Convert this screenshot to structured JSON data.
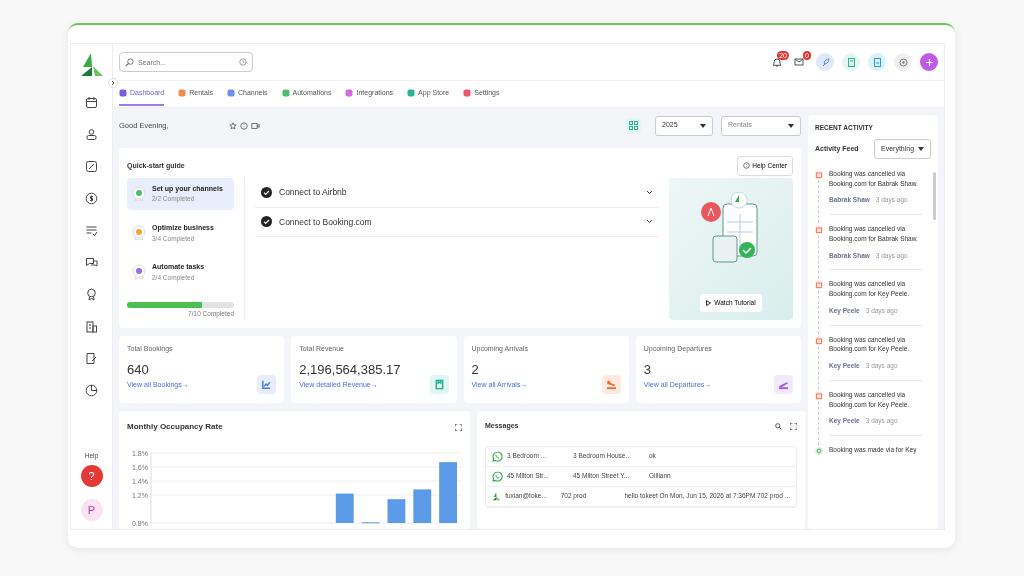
{
  "sidebar": {
    "help_label": "Help",
    "help_button": "?",
    "avatar": "P"
  },
  "header": {
    "search": {
      "placeholder": "Search..."
    },
    "notifications": "20",
    "messages": "0"
  },
  "tabs": [
    {
      "label": "Dashboard",
      "selected": true,
      "color": "#7c5ce0"
    },
    {
      "label": "Rentals",
      "selected": false,
      "color": "#f08a4b"
    },
    {
      "label": "Channels",
      "selected": false,
      "color": "#6f8fe8"
    },
    {
      "label": "Automations",
      "selected": false,
      "color": "#4cbf6b"
    },
    {
      "label": "Integrations",
      "selected": false,
      "color": "#d46be0"
    },
    {
      "label": "App Store",
      "selected": false,
      "color": "#2bb39a"
    },
    {
      "label": "Settings",
      "selected": false,
      "color": "#e8596a"
    }
  ],
  "greeting": "Good Evening,",
  "filters": {
    "year": "2025",
    "rentals": {
      "placeholder": "Rentals"
    }
  },
  "quick_start": {
    "title": "Quick-start guide",
    "help_button": "Help Center",
    "steps": [
      {
        "title": "Set up your channels",
        "progress": "2/2 Completed",
        "selected": true,
        "color": "#4cbf6b"
      },
      {
        "title": "Optimize business",
        "progress": "3/4 Completed",
        "selected": false,
        "color": "#f0a830"
      },
      {
        "title": "Automate tasks",
        "progress": "2/4 Completed",
        "selected": false,
        "color": "#9b6be0"
      }
    ],
    "level": 0.7,
    "progress_text": "7/10 Completed",
    "tasks": [
      {
        "label": "Connect to Airbnb",
        "checked": true
      },
      {
        "label": "Connect to Booking.com",
        "checked": true
      }
    ],
    "tutorial_button": "Watch Tutorial"
  },
  "stats": [
    {
      "label": "Total Bookings",
      "value": "640",
      "link": "View all Bookings→",
      "kind": "chart",
      "color": "#4a7fd0"
    },
    {
      "label": "Total Revenue",
      "value": "2,196,564,385.17",
      "link": "View detailed Revenue→",
      "kind": "receipt",
      "color": "#2bb39a"
    },
    {
      "label": "Upcoming Arrivals",
      "value": "2",
      "link": "View all Arrivals→",
      "kind": "arrival",
      "color": "#f06a2a"
    },
    {
      "label": "Upcoming Departures",
      "value": "3",
      "link": "View all Departures→",
      "kind": "departure",
      "color": "#a05ce0"
    }
  ],
  "occupancy": {
    "title": "Monthly Occupancy Rate",
    "chart_data": {
      "type": "bar",
      "grid": true,
      "ylim": [
        0.8,
        1.8
      ],
      "yticks": [
        {
          "value": 0.8,
          "label": "0.8%"
        },
        {
          "value": 1.2,
          "label": "1.2%"
        },
        {
          "value": 1.4,
          "label": "1.4%"
        },
        {
          "value": 1.6,
          "label": "1.6%"
        },
        {
          "value": 1.8,
          "label": "1.8%"
        }
      ],
      "series": [
        {
          "color": "#5b9be8",
          "values": [
            null,
            null,
            null,
            null,
            null,
            null,
            null,
            1.22,
            0.81,
            1.14,
            1.28,
            1.67
          ]
        }
      ]
    }
  },
  "messages": {
    "title": "Messages",
    "rows": [
      {
        "kind": "whatsapp",
        "guest": "3 Bedroom ...",
        "rental": "3 Bedroom House...",
        "text": "ok"
      },
      {
        "kind": "whatsapp",
        "guest": "45 Milton Str...",
        "rental": "45 Milton Street Y...",
        "text": "Gilliann"
      },
      {
        "kind": "tokeet",
        "guest": "fuxian@toke...",
        "rental": "702 prod",
        "text": "hello tokeet On Mon, Jun 15, 2026 at 7:36PM 702 prod ..."
      }
    ]
  },
  "activity": {
    "title": "RECENT ACTIVITY",
    "feed_label": "Activity Feed",
    "feed_select": "Everything",
    "items": [
      {
        "kind": "cancelled",
        "text": "Booking was cancelled via Booking.com for Babrak Shaw.",
        "author": "Babrak Shaw",
        "time": "3 days ago"
      },
      {
        "kind": "cancelled",
        "text": "Booking was cancelled via Booking.com for Babrak Shaw.",
        "author": "Babrak Shaw",
        "time": "3 days ago"
      },
      {
        "kind": "cancelled",
        "text": "Booking was cancelled via Booking.com for Key Peele.",
        "author": "Key Peele",
        "time": "3 days ago"
      },
      {
        "kind": "cancelled",
        "text": "Booking was cancelled via Booking.com for Key Peele.",
        "author": "Key Peele",
        "time": "3 days ago"
      },
      {
        "kind": "cancelled",
        "text": "Booking was cancelled via Booking.com for Key Peele.",
        "author": "Key Peele",
        "time": "3 days ago"
      },
      {
        "kind": "made",
        "text": "Booking was made via for Key"
      }
    ]
  }
}
